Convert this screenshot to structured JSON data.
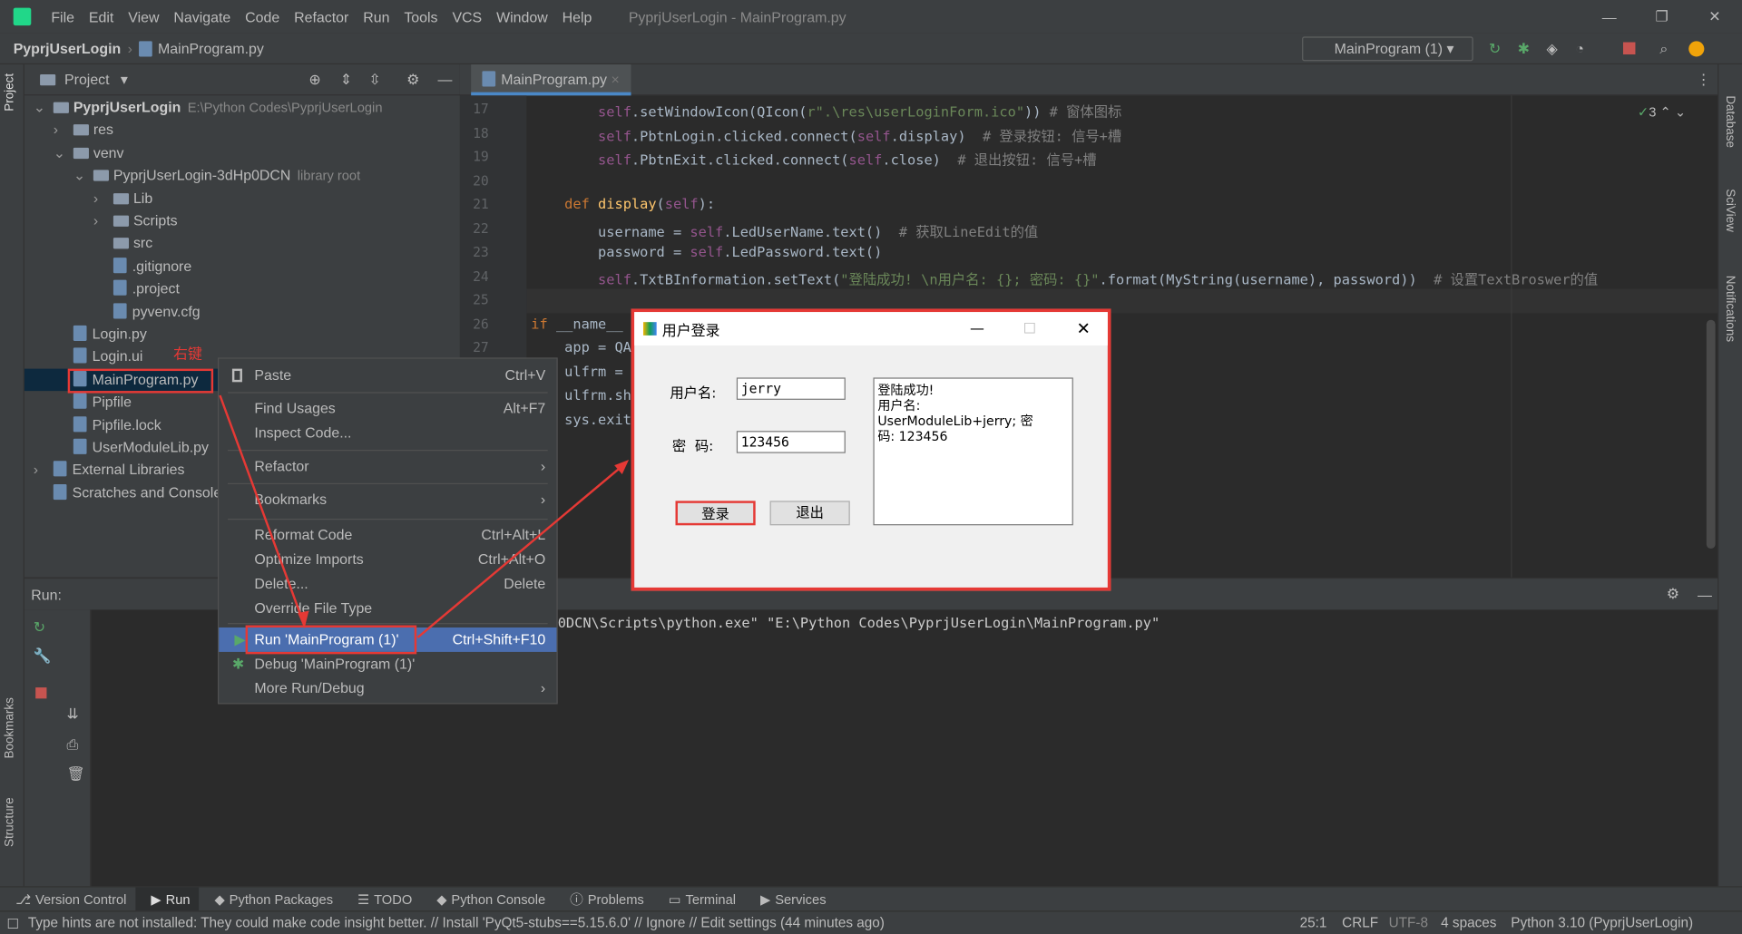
{
  "menubar": {
    "items": [
      "File",
      "Edit",
      "View",
      "Navigate",
      "Code",
      "Refactor",
      "Run",
      "Tools",
      "VCS",
      "Window",
      "Help"
    ],
    "title": "PyprjUserLogin - MainProgram.py"
  },
  "navbar": {
    "project": "PyprjUserLogin",
    "file": "MainProgram.py",
    "run_config": "MainProgram (1)"
  },
  "project_panel": {
    "title": "Project",
    "tree": [
      {
        "label": "PyprjUserLogin",
        "extra": "E:\\Python Codes\\PyprjUserLogin",
        "type": "folder",
        "depth": 0,
        "arrow": "v"
      },
      {
        "label": "res",
        "type": "folder",
        "depth": 1,
        "arrow": ">"
      },
      {
        "label": "venv",
        "type": "folder",
        "depth": 1,
        "arrow": "v"
      },
      {
        "label": "PyprjUserLogin-3dHp0DCN",
        "extra": "library root",
        "type": "folder",
        "depth": 2,
        "arrow": "v"
      },
      {
        "label": "Lib",
        "type": "folder",
        "depth": 3,
        "arrow": ">"
      },
      {
        "label": "Scripts",
        "type": "folder",
        "depth": 3,
        "arrow": ">"
      },
      {
        "label": "src",
        "type": "folder",
        "depth": 3,
        "arrow": ""
      },
      {
        "label": ".gitignore",
        "type": "file",
        "depth": 3,
        "arrow": ""
      },
      {
        "label": ".project",
        "type": "file",
        "depth": 3,
        "arrow": ""
      },
      {
        "label": "pyvenv.cfg",
        "type": "file",
        "depth": 3,
        "arrow": ""
      },
      {
        "label": "Login.py",
        "type": "file",
        "depth": 1,
        "arrow": ""
      },
      {
        "label": "Login.ui",
        "type": "file",
        "depth": 1,
        "arrow": ""
      },
      {
        "label": "MainProgram.py",
        "type": "file",
        "depth": 1,
        "arrow": "",
        "selected": true
      },
      {
        "label": "Pipfile",
        "type": "file",
        "depth": 1,
        "arrow": ""
      },
      {
        "label": "Pipfile.lock",
        "type": "file",
        "depth": 1,
        "arrow": ""
      },
      {
        "label": "UserModuleLib.py",
        "type": "file",
        "depth": 1,
        "arrow": ""
      },
      {
        "label": "External Libraries",
        "type": "lib",
        "depth": 0,
        "arrow": ">"
      },
      {
        "label": "Scratches and Consoles",
        "type": "lib",
        "depth": 0,
        "arrow": ""
      }
    ]
  },
  "annotation": "右键",
  "editor": {
    "tab": "MainProgram.py",
    "inspection_count": "3",
    "lines": [
      {
        "n": "17",
        "html": "        <span class='sf'>self</span>.setWindowIcon(QIcon(<span class='st'>r\".\\res\\userLoginForm.ico\"</span>)) <span class='cm'># 窗体图标</span>"
      },
      {
        "n": "18",
        "html": "        <span class='sf'>self</span>.PbtnLogin.clicked.connect(<span class='sf'>self</span>.display)  <span class='cm'># 登录按钮: 信号+槽</span>"
      },
      {
        "n": "19",
        "html": "        <span class='sf'>self</span>.PbtnExit.clicked.connect(<span class='sf'>self</span>.close)  <span class='cm'># 退出按钮: 信号+槽</span>"
      },
      {
        "n": "20",
        "html": ""
      },
      {
        "n": "21",
        "html": "    <span class='kw'>def</span> <span class='fn'>display</span>(<span class='sf'>self</span>):"
      },
      {
        "n": "22",
        "html": "        username = <span class='sf'>self</span>.LedUserName.text()  <span class='cm'># 获取LineEdit的值</span>"
      },
      {
        "n": "23",
        "html": "        password = <span class='sf'>self</span>.LedPassword.text()"
      },
      {
        "n": "24",
        "html": "        <span class='sf'>self</span>.TxtBInformation.setText(<span class='st'>\"登陆成功! \\n用户名: {}; 密码: {}\"</span>.format(MyString(username), password))  <span class='cm'># 设置TextBroswer的值</span>"
      },
      {
        "n": "25",
        "html": ""
      },
      {
        "n": "26",
        "html": "<span class='kw'>if</span> __name__"
      },
      {
        "n": "27",
        "html": "    app = QA"
      },
      {
        "n": "",
        "html": "    ulfrm = "
      },
      {
        "n": "",
        "html": "    ulfrm.sh"
      },
      {
        "n": "",
        "html": "    sys.exit"
      }
    ]
  },
  "context_menu": {
    "items": [
      {
        "label": "Paste",
        "shortcut": "Ctrl+V"
      },
      {
        "label": "Find Usages",
        "shortcut": "Alt+F7"
      },
      {
        "label": "Inspect Code...",
        "shortcut": ""
      },
      {
        "label": "Refactor",
        "shortcut": "›"
      },
      {
        "label": "Bookmarks",
        "shortcut": "›"
      },
      {
        "label": "Reformat Code",
        "shortcut": "Ctrl+Alt+L"
      },
      {
        "label": "Optimize Imports",
        "shortcut": "Ctrl+Alt+O"
      },
      {
        "label": "Delete...",
        "shortcut": "Delete"
      },
      {
        "label": "Override File Type",
        "shortcut": ""
      },
      {
        "label": "Run 'MainProgram (1)'",
        "shortcut": "Ctrl+Shift+F10"
      },
      {
        "label": "Debug 'MainProgram (1)'",
        "shortcut": ""
      },
      {
        "label": "More Run/Debug",
        "shortcut": "›"
      }
    ]
  },
  "run_panel": {
    "label": "Run:",
    "output": "0DCN\\Scripts\\python.exe\" \"E:\\Python Codes\\PyprjUserLogin\\MainProgram.py\""
  },
  "dialog": {
    "title": "用户登录",
    "username_label": "用户名:",
    "username_value": "jerry",
    "password_label": "密  码:",
    "password_value": "123456",
    "login_button": "登录",
    "exit_button": "退出",
    "info_text": "登陆成功!\n用户名:\nUserModuleLib+jerry; 密\n码: 123456"
  },
  "bottom_tabs": [
    "Version Control",
    "Run",
    "Python Packages",
    "TODO",
    "Python Console",
    "Problems",
    "Terminal",
    "Services"
  ],
  "side_tabs": {
    "left": [
      "Project",
      "Bookmarks",
      "Structure"
    ],
    "right": [
      "Database",
      "SciView",
      "Notifications"
    ]
  },
  "status": {
    "message": "Type hints are not installed: They could make code insight better. // Install 'PyQt5-stubs==5.15.6.0' // Ignore // Edit settings (44 minutes ago)",
    "position": "25:1",
    "line_sep": "CRLF",
    "encoding": "UTF-8",
    "indent": "4 spaces",
    "interpreter": "Python 3.10 (PyprjUserLogin)"
  },
  "colors": {
    "accent": "#4b6eaf",
    "highlight_box": "#e53935",
    "bg": "#2b2b2b",
    "panel": "#3c3f41"
  }
}
